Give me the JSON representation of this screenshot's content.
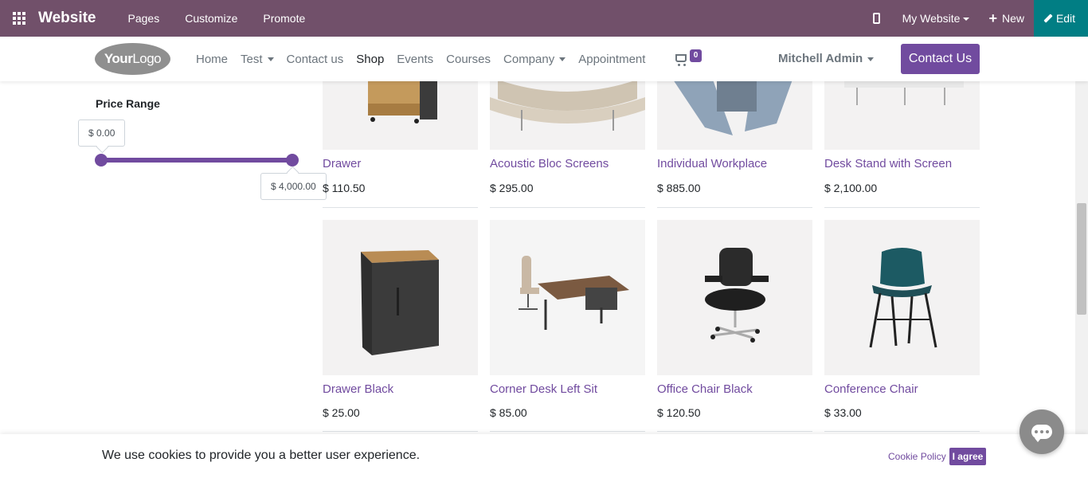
{
  "admin_bar": {
    "brand": "Website",
    "menu": [
      "Pages",
      "Customize",
      "Promote"
    ],
    "website_selector": "My Website",
    "new_label": "New",
    "edit_label": "Edit",
    "color": "#71506a"
  },
  "site_header": {
    "logo": {
      "part1": "Your",
      "part2": "Logo"
    },
    "nav": {
      "home": "Home",
      "test": "Test",
      "contact": "Contact us",
      "shop": "Shop",
      "events": "Events",
      "courses": "Courses",
      "company": "Company",
      "appointment": "Appointment"
    },
    "cart_count": "0",
    "user": "Mitchell Admin",
    "contact_button": "Contact Us",
    "accent": "#714b9f"
  },
  "sidebar": {
    "price_range": {
      "title": "Price Range",
      "min_label": "$ 0.00",
      "max_label": "$ 4,000.00",
      "min_value": 0,
      "max_value": 4000
    }
  },
  "products": [
    {
      "name": "Drawer",
      "price": "$ 110.50",
      "image": "drawer"
    },
    {
      "name": "Acoustic Bloc Screens",
      "price": "$ 295.00",
      "image": "acoustic-screens"
    },
    {
      "name": "Individual Workplace",
      "price": "$ 885.00",
      "image": "workplace"
    },
    {
      "name": "Desk Stand with Screen",
      "price": "$ 2,100.00",
      "image": "desk-stand"
    },
    {
      "name": "Drawer Black",
      "price": "$ 25.00",
      "image": "drawer-black"
    },
    {
      "name": "Corner Desk Left Sit",
      "price": "$ 85.00",
      "image": "corner-desk"
    },
    {
      "name": "Office Chair Black",
      "price": "$ 120.50",
      "image": "office-chair"
    },
    {
      "name": "Conference Chair",
      "price": "$ 33.00",
      "image": "conference-chair"
    }
  ],
  "cookie_bar": {
    "text": "We use cookies to provide you a better user experience.",
    "policy_link": "Cookie Policy",
    "agree_button": "I agree"
  }
}
